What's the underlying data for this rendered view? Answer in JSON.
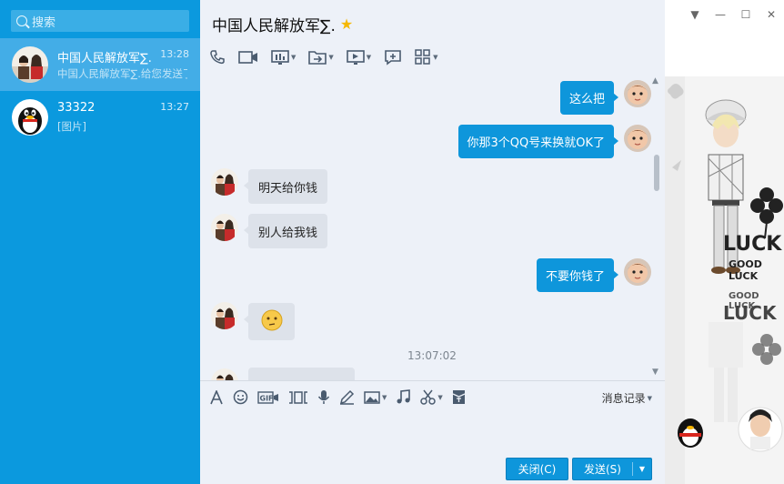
{
  "sidebar": {
    "search_placeholder": "搜索",
    "conversations": [
      {
        "name": "中国人民解放军∑.",
        "time": "13:28",
        "preview": "中国人民解放军∑.给您发送了",
        "selected": true
      },
      {
        "name": "33322",
        "time": "13:27",
        "preview": "[图片]",
        "selected": false
      }
    ]
  },
  "chat": {
    "title": "中国人民解放军∑.",
    "title_icon": "star-icon",
    "messages": [
      {
        "dir": "out",
        "text": "这么把"
      },
      {
        "dir": "out",
        "text": "你那3个QQ号来换就OK了"
      },
      {
        "dir": "in",
        "text": "明天给你钱"
      },
      {
        "dir": "in",
        "text": "别人给我钱"
      },
      {
        "dir": "out",
        "text": "不要你钱了"
      },
      {
        "dir": "in",
        "text": "",
        "emoji": "face-emoji"
      },
      {
        "dir": "in",
        "text": ""
      }
    ],
    "timestamp": "13:07:02"
  },
  "input": {
    "history_label": "消息记录",
    "close_label": "关闭(C)",
    "send_label": "发送(S)"
  },
  "show_panel": {
    "lucky_1": "LUCK",
    "good_luck_1": "GOOD LUCK",
    "good_luck_2": "GOOD LUCK",
    "lucky_2": "LUCK"
  },
  "colors": {
    "sidebar": "#0b99de",
    "selected": "#43ade7",
    "bubble_out": "#0e96db",
    "bubble_in": "#dde2ea",
    "chat_bg": "#edf1f8"
  }
}
